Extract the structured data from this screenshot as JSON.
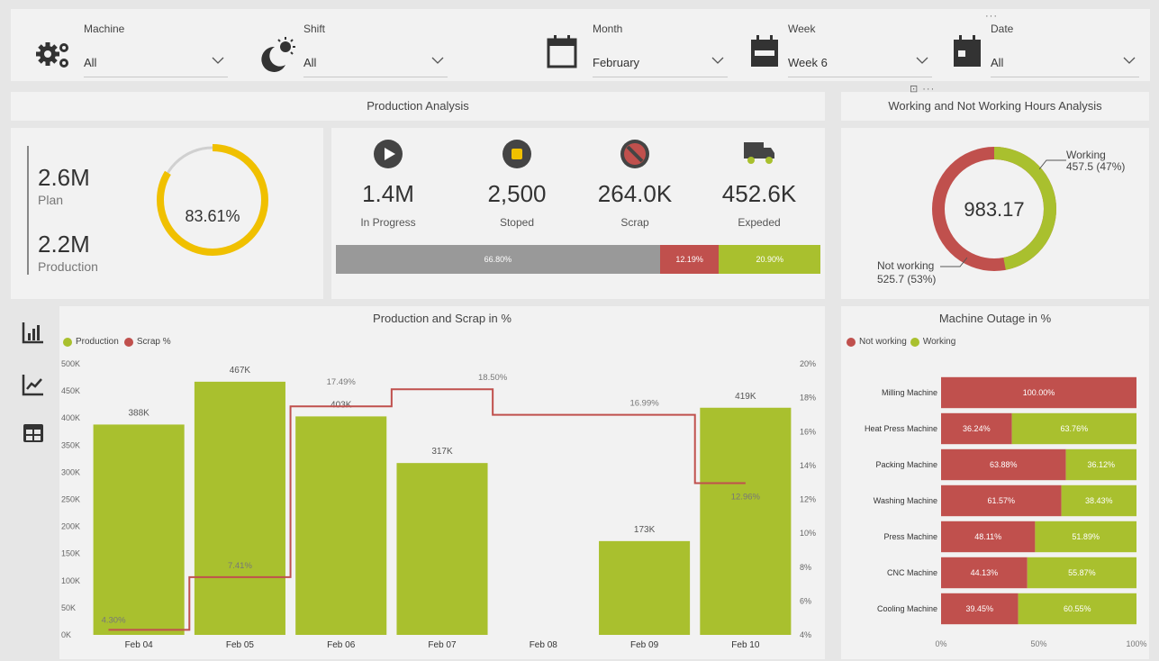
{
  "filters": {
    "machine": {
      "label": "Machine",
      "value": "All"
    },
    "shift": {
      "label": "Shift",
      "value": "All"
    },
    "month": {
      "label": "Month",
      "value": "February"
    },
    "week": {
      "label": "Week",
      "value": "Week 6"
    },
    "date": {
      "label": "Date",
      "value": "All"
    }
  },
  "production_analysis": {
    "title": "Production Analysis",
    "plan_value": "2.6M",
    "plan_label": "Plan",
    "production_value": "2.2M",
    "production_label": "Production",
    "gauge_value": "83.61%",
    "gauge_fraction": 0.8361,
    "kpis": [
      {
        "icon": "play-icon",
        "value": "1.4M",
        "label": "In Progress"
      },
      {
        "icon": "stop-icon",
        "value": "2,500",
        "label": "Stoped"
      },
      {
        "icon": "ban-icon",
        "value": "264.0K",
        "label": "Scrap"
      },
      {
        "icon": "truck-icon",
        "value": "452.6K",
        "label": "Expeded"
      }
    ],
    "stack": [
      {
        "label": "66.80%",
        "value": 66.8,
        "color": "#999999"
      },
      {
        "label": "12.19%",
        "value": 12.19,
        "color": "#c0504d"
      },
      {
        "label": "20.90%",
        "value": 20.9,
        "color": "#a9c02e"
      }
    ]
  },
  "working_hours": {
    "title": "Working and Not Working Hours Analysis",
    "total": "983.17",
    "working_label": "Working",
    "working_value": "457.5 (47%)",
    "working_fraction": 0.47,
    "not_working_label": "Not working",
    "not_working_value": "525.7 (53%)",
    "colors": {
      "working": "#a9c02e",
      "not_working": "#c0504d"
    }
  },
  "sidebar_icons": [
    "bar-chart-icon",
    "line-chart-icon",
    "table-icon"
  ],
  "chart_data": [
    {
      "type": "bar",
      "title": "Production and Scrap in %",
      "legend": [
        "Production",
        "Scrap %"
      ],
      "colors": {
        "Production": "#a9c02e",
        "Scrap %": "#c0504d"
      },
      "categories": [
        "Feb 04",
        "Feb 05",
        "Feb 06",
        "Feb 07",
        "Feb 08",
        "Feb 09",
        "Feb 10"
      ],
      "series": [
        {
          "name": "Production",
          "values": [
            388,
            467,
            403,
            317,
            null,
            173,
            419
          ],
          "labels": [
            "388K",
            "467K",
            "403K",
            "317K",
            "",
            "173K",
            "419K"
          ]
        },
        {
          "name": "Scrap %",
          "values": [
            4.3,
            7.41,
            17.49,
            18.5,
            16.99,
            16.99,
            12.96
          ],
          "labels": [
            "4.30%",
            "7.41%",
            "17.49%",
            "18.50%",
            "",
            "16.99%",
            "12.96%"
          ]
        }
      ],
      "y_ticks": [
        "500K",
        "450K",
        "400K",
        "350K",
        "300K",
        "250K",
        "200K",
        "150K",
        "100K",
        "50K",
        "0K"
      ],
      "y2_ticks": [
        "20%",
        "18%",
        "16%",
        "14%",
        "12%",
        "10%",
        "8%",
        "6%",
        "4%"
      ],
      "ylim": [
        0,
        500
      ],
      "y2lim": [
        4,
        20
      ]
    },
    {
      "type": "bar",
      "title": "Machine Outage in %",
      "legend": [
        "Not working",
        "Working"
      ],
      "colors": {
        "Not working": "#c0504d",
        "Working": "#a9c02e"
      },
      "categories": [
        "Milling Machine",
        "Heat Press Machine",
        "Packing Machine",
        "Washing Machine",
        "Press Machine",
        "CNC Machine",
        "Cooling Machine"
      ],
      "series": [
        {
          "name": "Not working",
          "values": [
            100.0,
            36.24,
            63.88,
            61.57,
            48.11,
            44.13,
            39.45
          ],
          "labels": [
            "100.00%",
            "36.24%",
            "63.88%",
            "61.57%",
            "48.11%",
            "44.13%",
            "39.45%"
          ]
        },
        {
          "name": "Working",
          "values": [
            0,
            63.76,
            36.12,
            38.43,
            51.89,
            55.87,
            60.55
          ],
          "labels": [
            "",
            "63.76%",
            "36.12%",
            "38.43%",
            "51.89%",
            "55.87%",
            "60.55%"
          ]
        }
      ],
      "x_ticks": [
        "0%",
        "50%",
        "100%"
      ],
      "xlim": [
        0,
        100
      ]
    }
  ]
}
